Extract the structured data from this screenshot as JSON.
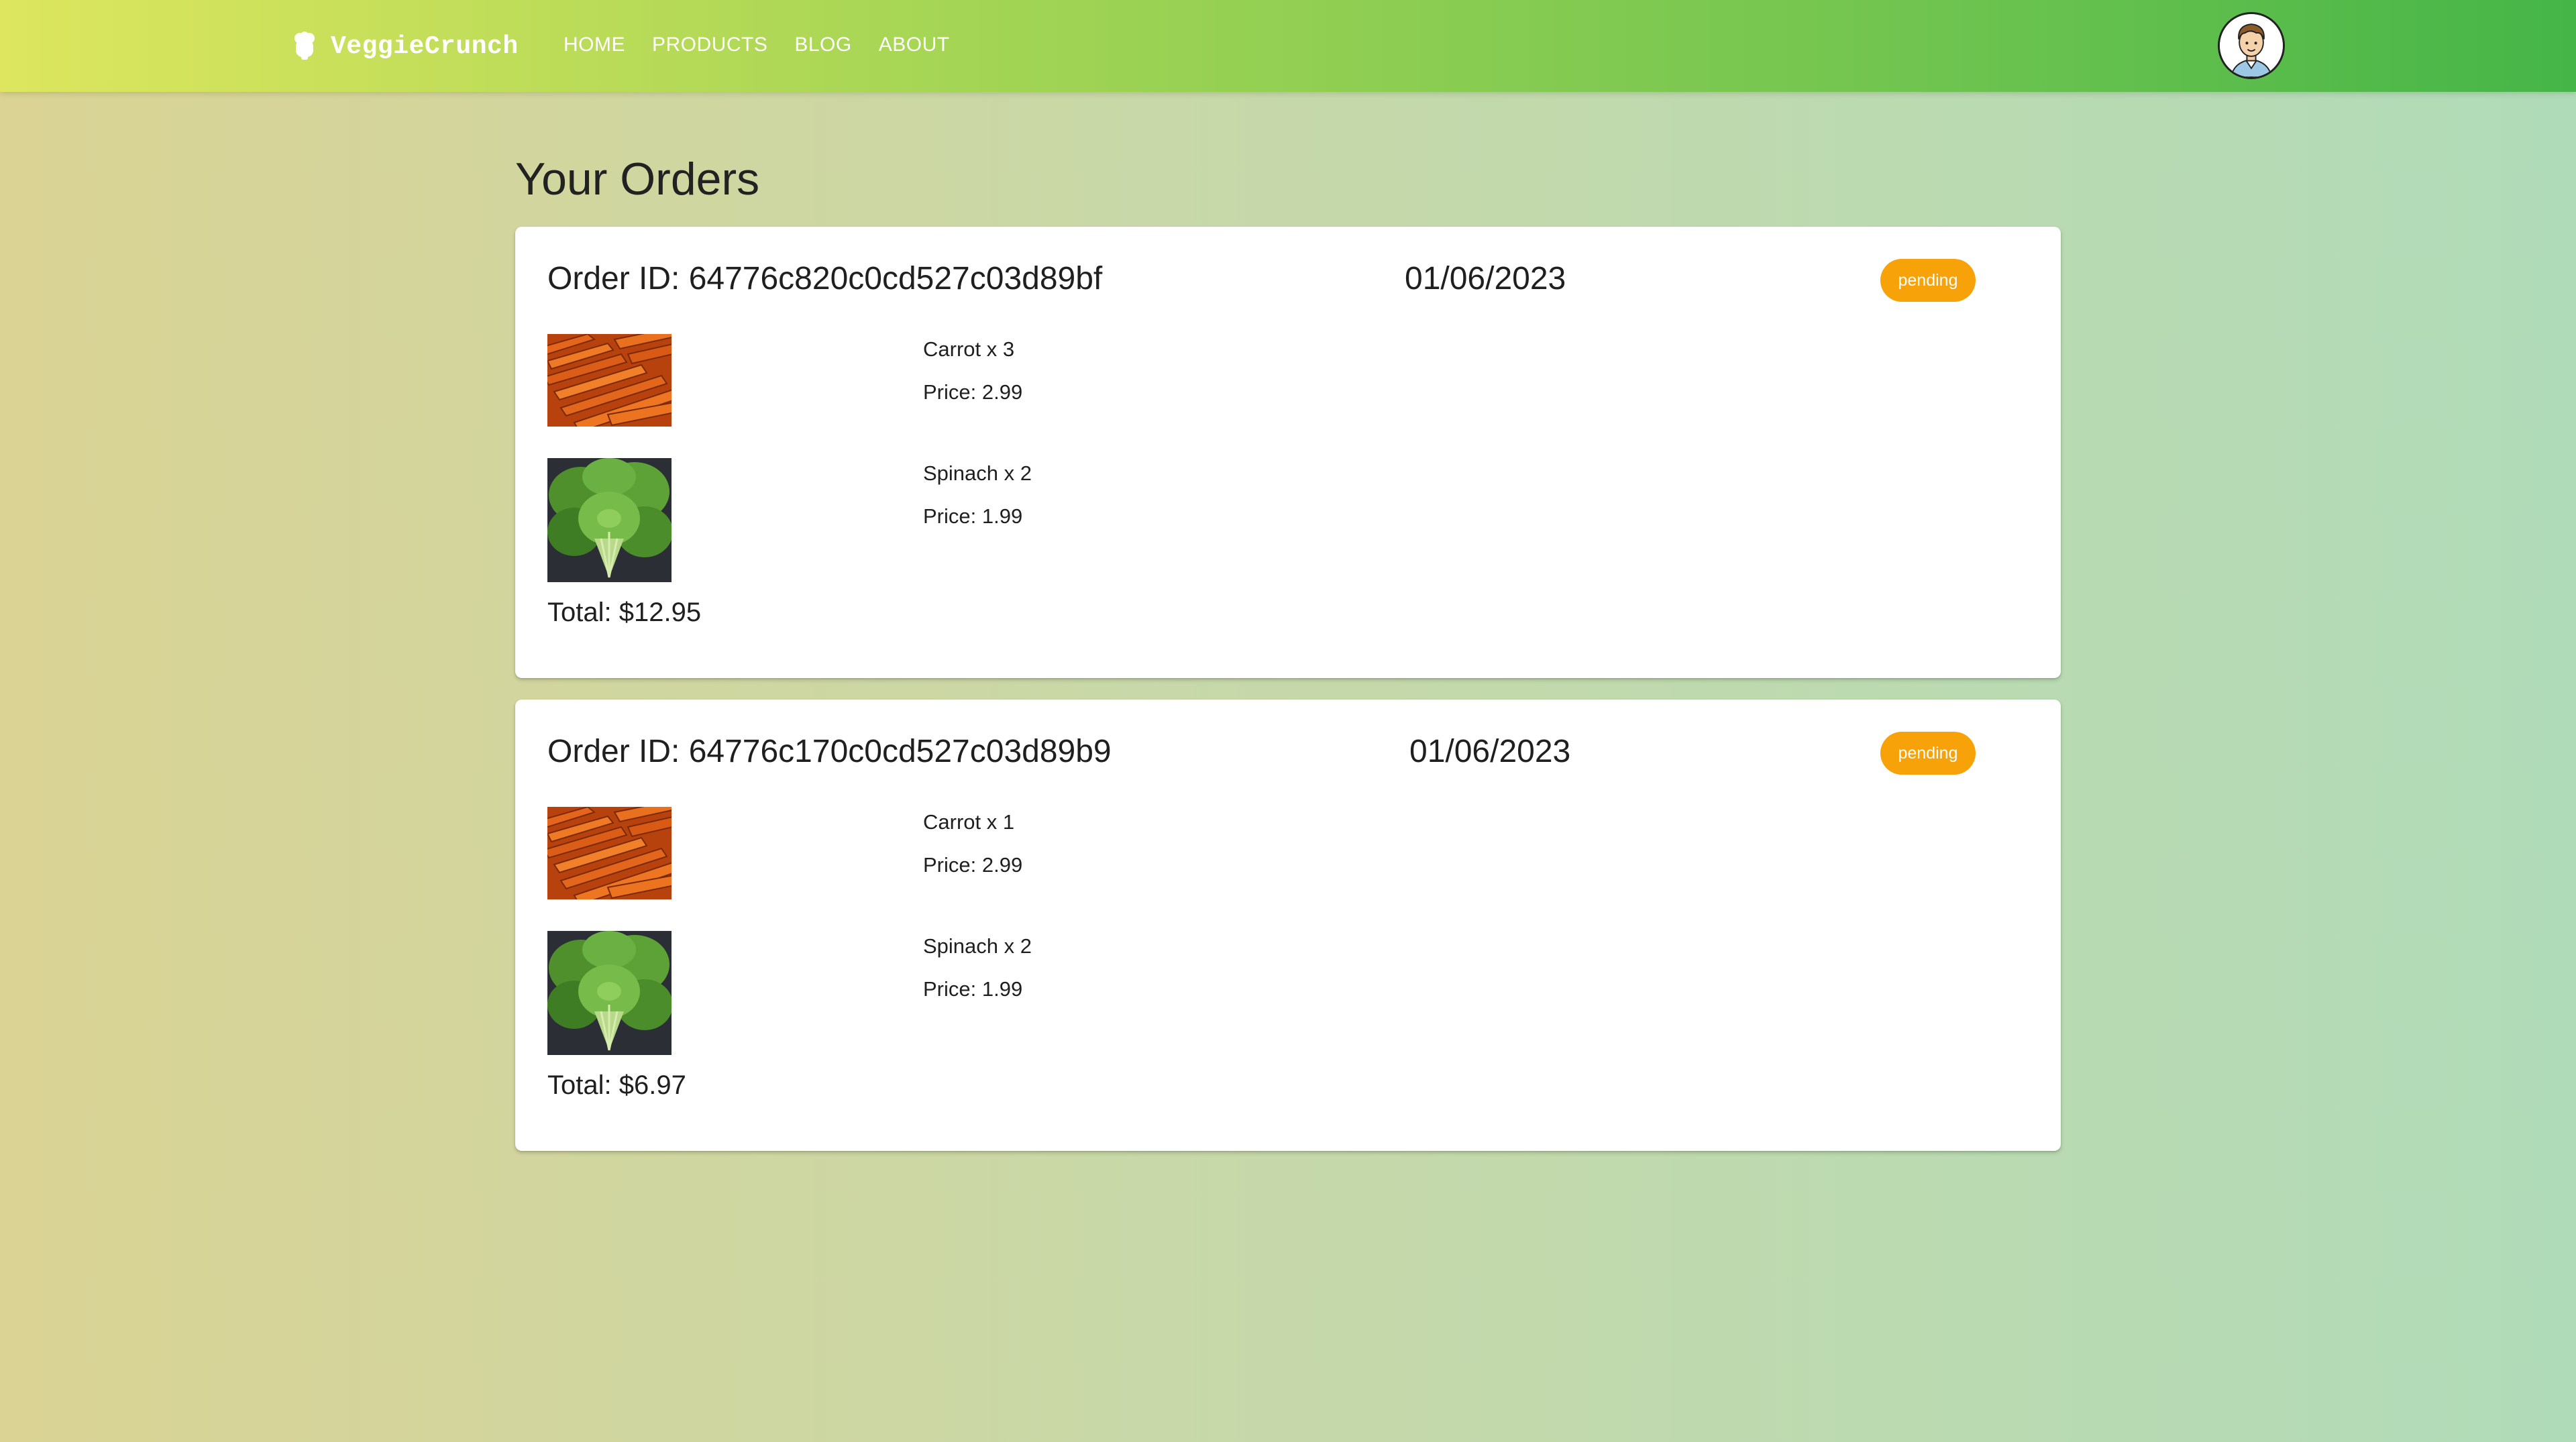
{
  "brand": {
    "name": "VeggieCrunch",
    "logo_icon": "broccoli-icon"
  },
  "nav": {
    "items": [
      {
        "label": "HOME"
      },
      {
        "label": "PRODUCTS"
      },
      {
        "label": "BLOG"
      },
      {
        "label": "ABOUT"
      }
    ]
  },
  "user": {
    "avatar_icon": "user-avatar-icon"
  },
  "page": {
    "title": "Your Orders"
  },
  "orders": [
    {
      "id_text": "Order ID: 64776c820c0cd527c03d89bf",
      "date": "01/06/2023",
      "status": "pending",
      "items": [
        {
          "name_qty": "Carrot x 3",
          "price": "Price: 2.99",
          "image_icon": "carrot-image"
        },
        {
          "name_qty": "Spinach x 2",
          "price": "Price: 1.99",
          "image_icon": "spinach-image"
        }
      ],
      "total": "Total: $12.95"
    },
    {
      "id_text": "Order ID: 64776c170c0cd527c03d89b9",
      "date": "01/06/2023",
      "status": "pending",
      "items": [
        {
          "name_qty": "Carrot x 1",
          "price": "Price: 2.99",
          "image_icon": "carrot-image"
        },
        {
          "name_qty": "Spinach x 2",
          "price": "Price: 1.99",
          "image_icon": "spinach-image"
        }
      ],
      "total": "Total: $6.97"
    }
  ],
  "colors": {
    "appbar_start": "#dde65e",
    "appbar_end": "#45b548",
    "status_pending": "#f7a208",
    "card_bg": "#ffffff"
  }
}
